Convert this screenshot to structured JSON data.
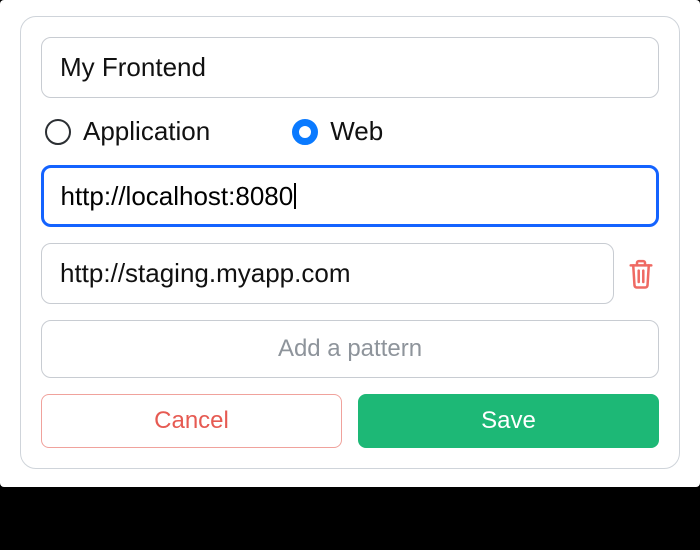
{
  "form": {
    "name_value": "My Frontend",
    "type": {
      "application_label": "Application",
      "web_label": "Web",
      "selected": "web"
    },
    "patterns": [
      {
        "value": "http://localhost:8080",
        "focused": true
      },
      {
        "value": "http://staging.myapp.com",
        "focused": false,
        "removable": true
      }
    ],
    "add_pattern_label": "Add a pattern",
    "buttons": {
      "cancel": "Cancel",
      "save": "Save"
    }
  },
  "colors": {
    "accent_blue": "#1463ff",
    "radio_blue": "#0a7aff",
    "save_green": "#1db876",
    "cancel_red": "#e65a52",
    "trash_red": "#ef6a63"
  }
}
